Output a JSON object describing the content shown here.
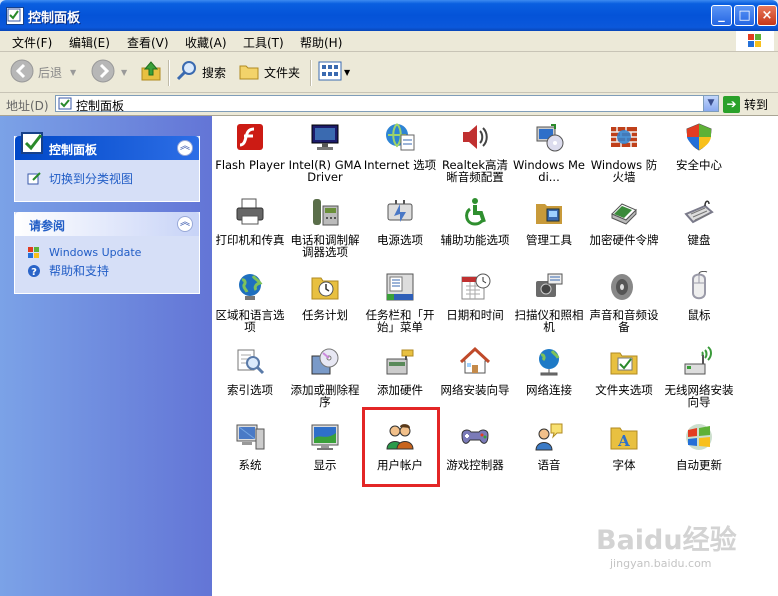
{
  "window": {
    "title": "控制面板",
    "minimize": "_",
    "maximize": "□",
    "close": "×"
  },
  "menu": [
    "文件(F)",
    "编辑(E)",
    "查看(V)",
    "收藏(A)",
    "工具(T)",
    "帮助(H)"
  ],
  "toolbar": {
    "back": "后退",
    "search": "搜索",
    "folders": "文件夹"
  },
  "address": {
    "label": "地址(D)",
    "value": "控制面板",
    "go": "转到"
  },
  "sidebar": {
    "panel1": {
      "title": "控制面板",
      "links": [
        "切换到分类视图"
      ]
    },
    "panel2": {
      "title": "请参阅",
      "links": [
        "Windows Update",
        "帮助和支持"
      ]
    }
  },
  "items": [
    {
      "label": "Flash Player",
      "icon": "flash-icon",
      "color": "#cc1b14"
    },
    {
      "label": "Intel(R) GMA Driver",
      "icon": "monitor-icon",
      "color": "#1c1c6b"
    },
    {
      "label": "Internet 选项",
      "icon": "internet-options-icon",
      "color": "#2e84d4"
    },
    {
      "label": "Realtek高清晰音频配置",
      "icon": "speaker-icon",
      "color": "#c03030"
    },
    {
      "label": "Windows Medi...",
      "icon": "windows-media-icon",
      "color": "#2e6fc9"
    },
    {
      "label": "Windows 防火墙",
      "icon": "firewall-icon",
      "color": "#c0401a"
    },
    {
      "label": "安全中心",
      "icon": "security-shield-icon",
      "color": "#2e7d32"
    },
    {
      "label": "打印机和传真",
      "icon": "printer-icon",
      "color": "#666666"
    },
    {
      "label": "电话和调制解调器选项",
      "icon": "phone-icon",
      "color": "#5a6e4a"
    },
    {
      "label": "电源选项",
      "icon": "power-icon",
      "color": "#4a78c6"
    },
    {
      "label": "辅助功能选项",
      "icon": "accessibility-icon",
      "color": "#2f8f2f"
    },
    {
      "label": "管理工具",
      "icon": "admin-tools-icon",
      "color": "#c89a3a"
    },
    {
      "label": "加密硬件令牌",
      "icon": "token-icon",
      "color": "#3a8a3a"
    },
    {
      "label": "键盘",
      "icon": "keyboard-icon",
      "color": "#7a7a8a"
    },
    {
      "label": "区域和语言选项",
      "icon": "globe-icon",
      "color": "#1e6fbf"
    },
    {
      "label": "任务计划",
      "icon": "folder-clock-icon",
      "color": "#e8c040"
    },
    {
      "label": "任务栏和「开始」菜单",
      "icon": "taskbar-icon",
      "color": "#2e5fb8"
    },
    {
      "label": "日期和时间",
      "icon": "calendar-icon",
      "color": "#888888"
    },
    {
      "label": "扫描仪和照相机",
      "icon": "camera-icon",
      "color": "#6a6a6a"
    },
    {
      "label": "声音和音频设备",
      "icon": "speaker-audio-icon",
      "color": "#888888"
    },
    {
      "label": "鼠标",
      "icon": "mouse-icon",
      "color": "#9a9aa8"
    },
    {
      "label": "索引选项",
      "icon": "magnifier-icon",
      "color": "#5a7aa8"
    },
    {
      "label": "添加或删除程序",
      "icon": "cd-box-icon",
      "color": "#7a9ac8"
    },
    {
      "label": "添加硬件",
      "icon": "hardware-icon",
      "color": "#5a8a5a"
    },
    {
      "label": "网络安装向导",
      "icon": "home-network-icon",
      "color": "#c04a2a"
    },
    {
      "label": "网络连接",
      "icon": "network-globe-icon",
      "color": "#1e7ac6"
    },
    {
      "label": "文件夹选项",
      "icon": "folder-check-icon",
      "color": "#e8c040"
    },
    {
      "label": "无线网络安装向导",
      "icon": "wireless-icon",
      "color": "#3a9a3a"
    },
    {
      "label": "系统",
      "icon": "computer-icon",
      "color": "#4a7ac6"
    },
    {
      "label": "显示",
      "icon": "display-icon",
      "color": "#2e6fc9"
    },
    {
      "label": "用户帐户",
      "icon": "users-icon",
      "color": "#c8641e"
    },
    {
      "label": "游戏控制器",
      "icon": "gamepad-icon",
      "color": "#7a7ab8"
    },
    {
      "label": "语音",
      "icon": "speech-icon",
      "color": "#3a7ac6"
    },
    {
      "label": "字体",
      "icon": "fonts-folder-icon",
      "color": "#e8c040"
    },
    {
      "label": "自动更新",
      "icon": "windows-update-icon",
      "color": "#2e7d32"
    }
  ],
  "highlighted_item": "用户帐户",
  "watermark": {
    "brand": "Baidu经验",
    "url": "jingyan.baidu.com"
  }
}
